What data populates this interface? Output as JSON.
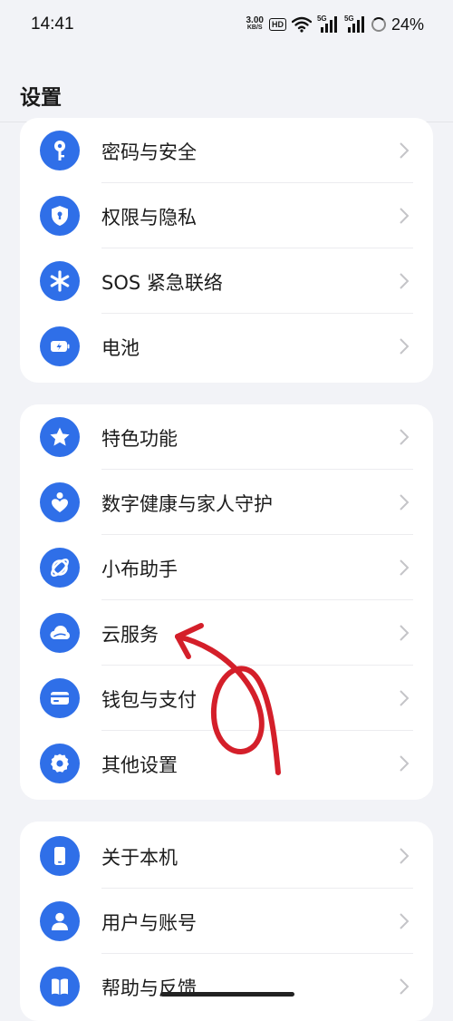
{
  "status": {
    "time": "14:41",
    "net_speed_value": "3.00",
    "net_speed_unit": "KB/S",
    "hd_badge": "HD",
    "signal1_label": "5G",
    "signal2_label": "5G",
    "battery": "24%"
  },
  "header": {
    "title": "设置"
  },
  "groups": [
    {
      "items": [
        {
          "label": "密码与安全",
          "icon": "key-icon"
        },
        {
          "label": "权限与隐私",
          "icon": "shield-icon"
        },
        {
          "label": "SOS 紧急联络",
          "icon": "asterisk-icon"
        },
        {
          "label": "电池",
          "icon": "battery-icon"
        }
      ]
    },
    {
      "items": [
        {
          "label": "特色功能",
          "icon": "star-icon"
        },
        {
          "label": "数字健康与家人守护",
          "icon": "heart-person-icon"
        },
        {
          "label": "小布助手",
          "icon": "assistant-icon"
        },
        {
          "label": "云服务",
          "icon": "cloud-icon"
        },
        {
          "label": "钱包与支付",
          "icon": "wallet-icon"
        },
        {
          "label": "其他设置",
          "icon": "gear-icon"
        }
      ]
    },
    {
      "items": [
        {
          "label": "关于本机",
          "icon": "phone-icon"
        },
        {
          "label": "用户与账号",
          "icon": "user-icon"
        },
        {
          "label": "帮助与反馈",
          "icon": "help-book-icon"
        }
      ]
    }
  ],
  "colors": {
    "accent": "#2f6fe8",
    "annotation": "#d41f2a",
    "background": "#f2f3f7"
  }
}
